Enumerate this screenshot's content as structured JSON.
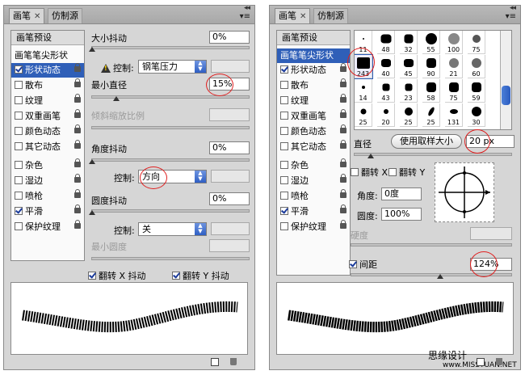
{
  "left": {
    "tabs": [
      {
        "label": "画笔"
      },
      {
        "label": "仿制源"
      }
    ],
    "list": {
      "header": "画笔预设",
      "items": [
        {
          "label": "画笔笔尖形状"
        },
        {
          "label": "形状动态",
          "checked": true,
          "selected": true
        },
        {
          "label": "散布",
          "checked": false
        },
        {
          "label": "纹理",
          "checked": false
        },
        {
          "label": "双重画笔",
          "checked": false
        },
        {
          "label": "颜色动态",
          "checked": false
        },
        {
          "label": "其它动态",
          "checked": false
        },
        {
          "label": "杂色",
          "checked": false
        },
        {
          "label": "湿边",
          "checked": false
        },
        {
          "label": "喷枪",
          "checked": false
        },
        {
          "label": "平滑",
          "checked": true
        },
        {
          "label": "保护纹理",
          "checked": false
        }
      ]
    },
    "settings": {
      "size_jitter_label": "大小抖动",
      "size_jitter_value": "0%",
      "control_label": "控制:",
      "control1_value": "钢笔压力",
      "min_diameter_label": "最小直径",
      "min_diameter_value": "15%",
      "tilt_scale_label": "倾斜缩放比例",
      "angle_jitter_label": "角度抖动",
      "angle_jitter_value": "0%",
      "control2_value": "方向",
      "roundness_jitter_label": "圆度抖动",
      "roundness_jitter_value": "0%",
      "control3_value": "关",
      "min_roundness_label": "最小圆度",
      "flip_x_label": "翻转 X 抖动",
      "flip_y_label": "翻转 Y 抖动"
    }
  },
  "right": {
    "tabs": [
      {
        "label": "画笔"
      },
      {
        "label": "仿制源"
      }
    ],
    "list": {
      "header": "画笔预设",
      "items": [
        {
          "label": "画笔笔尖形状",
          "selected": true
        },
        {
          "label": "形状动态",
          "checked": true
        },
        {
          "label": "散布",
          "checked": false
        },
        {
          "label": "纹理",
          "checked": false
        },
        {
          "label": "双重画笔",
          "checked": false
        },
        {
          "label": "颜色动态",
          "checked": false
        },
        {
          "label": "其它动态",
          "checked": false
        },
        {
          "label": "杂色",
          "checked": false
        },
        {
          "label": "湿边",
          "checked": false
        },
        {
          "label": "喷枪",
          "checked": false
        },
        {
          "label": "平滑",
          "checked": true
        },
        {
          "label": "保护纹理",
          "checked": false
        }
      ]
    },
    "brush_tips": {
      "row1": [
        "11",
        "48",
        "32",
        "55",
        "100",
        "75"
      ],
      "row2": [
        "243",
        "40",
        "45",
        "90",
        "21",
        "60"
      ],
      "row3": [
        "14",
        "43",
        "23",
        "58",
        "75",
        "59"
      ],
      "row4": [
        "25",
        "20",
        "25",
        "25",
        "131",
        "30"
      ]
    },
    "settings": {
      "diameter_label": "直径",
      "use_sample_label": "使用取样大小",
      "diameter_value": "20 px",
      "flip_x_label": "翻转 X",
      "flip_y_label": "翻转 Y",
      "angle_label": "角度:",
      "angle_value": "0度",
      "roundness_label": "圆度:",
      "roundness_value": "100%",
      "hardness_label": "硬度",
      "spacing_label": "间距",
      "spacing_value": "124%"
    },
    "watermark1": "思缘设计",
    "watermark2": "www.MISSYUAN.NET"
  }
}
